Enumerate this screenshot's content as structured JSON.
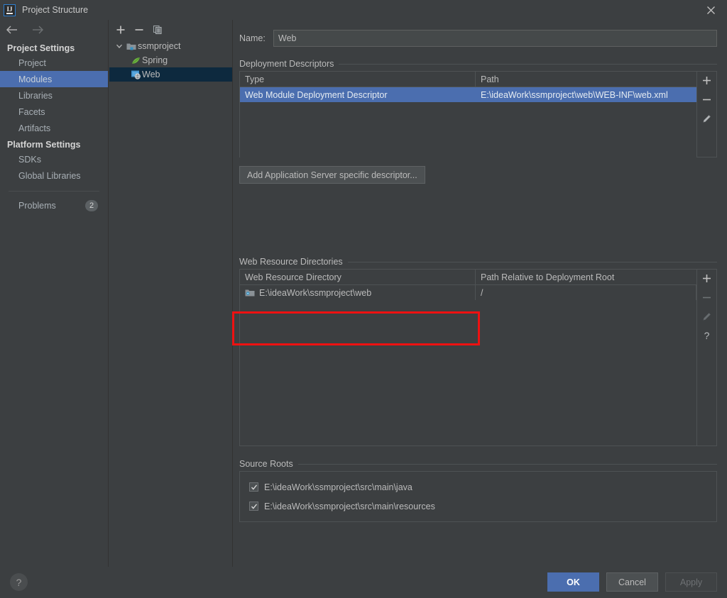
{
  "window": {
    "title": "Project Structure",
    "app_icon": "intellij-idea-logo",
    "close_icon": "close-icon"
  },
  "sidebar": {
    "back_icon": "arrow-left-icon",
    "forward_icon": "arrow-right-icon",
    "sections": [
      {
        "title": "Project Settings",
        "items": [
          {
            "label": "Project",
            "selected": false
          },
          {
            "label": "Modules",
            "selected": true
          },
          {
            "label": "Libraries",
            "selected": false
          },
          {
            "label": "Facets",
            "selected": false
          },
          {
            "label": "Artifacts",
            "selected": false
          }
        ]
      },
      {
        "title": "Platform Settings",
        "items": [
          {
            "label": "SDKs",
            "selected": false
          },
          {
            "label": "Global Libraries",
            "selected": false
          }
        ]
      }
    ],
    "problems": {
      "label": "Problems",
      "count": "2"
    }
  },
  "tree": {
    "toolbar": [
      {
        "icon": "add-icon",
        "enabled": true
      },
      {
        "icon": "remove-icon",
        "enabled": true
      },
      {
        "icon": "copy-icon",
        "enabled": true
      }
    ],
    "nodes": [
      {
        "label": "ssmproject",
        "icon": "module-folder-icon",
        "depth": 0,
        "expanded": true,
        "selected": false
      },
      {
        "label": "Spring",
        "icon": "spring-leaf-icon",
        "depth": 1,
        "selected": false
      },
      {
        "label": "Web",
        "icon": "web-module-icon",
        "depth": 1,
        "selected": true
      }
    ]
  },
  "main": {
    "name_label": "Name:",
    "name_value": "Web",
    "deployment_descriptors": {
      "title": "Deployment Descriptors",
      "columns": [
        "Type",
        "Path"
      ],
      "rows": [
        {
          "type": "Web Module Deployment Descriptor",
          "path": "E:\\ideaWork\\ssmproject\\web\\WEB-INF\\web.xml",
          "selected": true
        }
      ],
      "toolbar": [
        {
          "icon": "add-icon",
          "enabled": true
        },
        {
          "icon": "remove-icon",
          "enabled": true
        },
        {
          "icon": "edit-pencil-icon",
          "enabled": true
        }
      ],
      "add_descriptor_button": "Add Application Server specific descriptor..."
    },
    "web_resource_directories": {
      "title": "Web Resource Directories",
      "columns": [
        "Web Resource Directory",
        "Path Relative to Deployment Root"
      ],
      "rows": [
        {
          "directory": "E:\\ideaWork\\ssmproject\\web",
          "icon": "web-resource-folder-icon",
          "relative_path": "/"
        }
      ],
      "toolbar": [
        {
          "icon": "add-icon",
          "enabled": true
        },
        {
          "icon": "remove-icon",
          "enabled": false
        },
        {
          "icon": "edit-pencil-icon",
          "enabled": false
        },
        {
          "icon": "help-question-icon",
          "enabled": true
        }
      ]
    },
    "source_roots": {
      "title": "Source Roots",
      "items": [
        {
          "label": "E:\\ideaWork\\ssmproject\\src\\main\\java",
          "checked": true
        },
        {
          "label": "E:\\ideaWork\\ssmproject\\src\\main\\resources",
          "checked": true
        }
      ]
    }
  },
  "footer": {
    "help_icon": "help-question-icon",
    "buttons": [
      {
        "label": "OK",
        "style": "primary"
      },
      {
        "label": "Cancel",
        "style": "normal"
      },
      {
        "label": "Apply",
        "style": "disabled"
      }
    ]
  },
  "annotation": {
    "color": "#ee1111",
    "target": "web-resource-directory-column"
  }
}
